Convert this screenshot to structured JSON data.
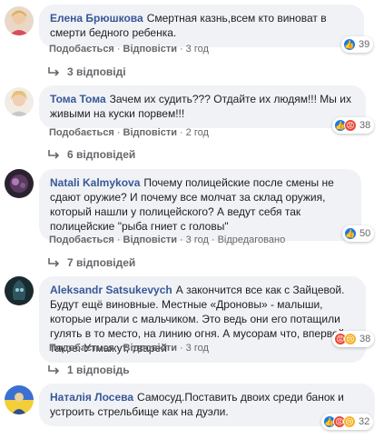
{
  "actions": {
    "like": "Подобається",
    "reply": "Відповісти",
    "dot": "·",
    "edited": "Відредаговано"
  },
  "comments": [
    {
      "author": "Елена Брюшкова",
      "text": "Смертная казнь,всем кто виноват в смерти бедного ребенка.",
      "time": "3 год",
      "reactions": {
        "icons": [
          "like"
        ],
        "count": "39"
      },
      "replies": "3 відповіді"
    },
    {
      "author": "Тома Тома",
      "text": "Зачем их судить??? Отдайте их людям!!! Мы их живыми на куски порвем!!!",
      "time": "2 год",
      "reactions": {
        "icons": [
          "like",
          "angry"
        ],
        "count": "38"
      },
      "replies": "6 відповідей"
    },
    {
      "author": "Natali Kalmykova",
      "text": "Почему полицейские после смены не сдают оружие? И почему все молчат за склад оружия, который нашли у полицейского? А ведут себя так полицейские \"рыба гниет с головы\"",
      "time": "3 год",
      "edited": true,
      "reactions": {
        "icons": [
          "like"
        ],
        "count": "50"
      },
      "replies": "7 відповідей"
    },
    {
      "author": "Aleksandr Satsukevych",
      "text": "А закончится все как с Зайцевой. Будут ещё виновные. Местные «Дроновы» - малыши, которые играли с мальчиком. Это ведь они его потащили гулять в то место, на линию огня. А мусорам что, впервой такое. Утмажут, тварей",
      "time": "3 год",
      "reactions": {
        "icons": [
          "angry",
          "sad"
        ],
        "count": "38"
      },
      "replies": "1 відповідь"
    },
    {
      "author": "Наталія Лосева",
      "text": "Самосуд.Поставить двоих среди банок и устроить стрельбище как на дуэли.",
      "time": "",
      "reactions": {
        "icons": [
          "like",
          "angry",
          "sad"
        ],
        "count": "32"
      },
      "replies": ""
    }
  ]
}
